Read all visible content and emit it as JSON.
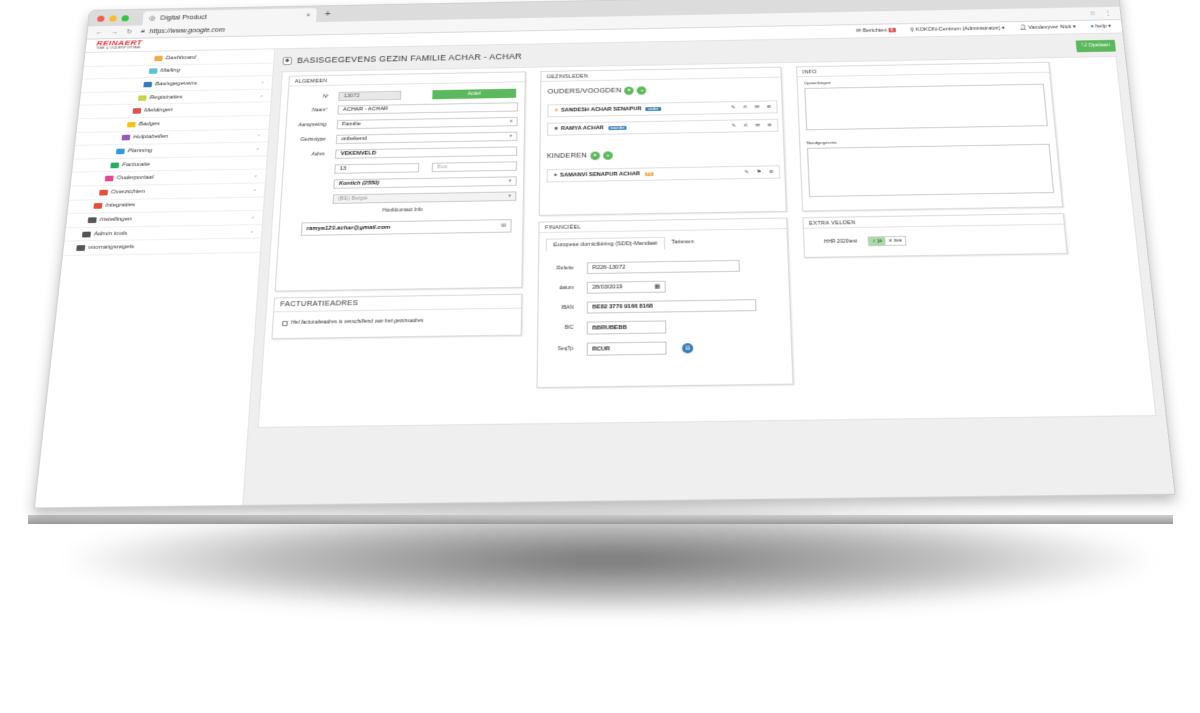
{
  "browser": {
    "tab_title": "Digital Product",
    "tab_close": "×",
    "new_tab": "+",
    "url": "https://www.google.com"
  },
  "header": {
    "logo_name": "REINAERT",
    "logo_sub": "TIBE & OUDERPORTAAL",
    "berichten": "Berichten",
    "berichten_count": "6",
    "location": "KOKON-Centrum (Administrator) ▾",
    "user": "Vandevyver Nick ▾",
    "help": "help ▾"
  },
  "sidebar": {
    "items": [
      {
        "label": "Dashboard",
        "color": "#f0ad4e",
        "chev": ""
      },
      {
        "label": "Mailing",
        "color": "#5bc0de",
        "chev": ""
      },
      {
        "label": "Basisgegevens",
        "color": "#337ab7",
        "chev": "‹"
      },
      {
        "label": "Registraties",
        "color": "#c8d44a",
        "chev": "‹"
      },
      {
        "label": "Meldingen",
        "color": "#d9534f",
        "chev": ""
      },
      {
        "label": "Badges",
        "color": "#f0c419",
        "chev": ""
      },
      {
        "label": "Hulptabellen",
        "color": "#9b59b6",
        "chev": "‹"
      },
      {
        "label": "Planning",
        "color": "#3498db",
        "chev": "‹"
      },
      {
        "label": "Facturatie",
        "color": "#27ae60",
        "chev": ""
      },
      {
        "label": "Ouderportaal",
        "color": "#e84393",
        "chev": "‹"
      },
      {
        "label": "Overzichten",
        "color": "#e74c3c",
        "chev": "‹"
      },
      {
        "label": "Integraties",
        "color": "#e74c3c",
        "chev": ""
      },
      {
        "label": "Instellingen",
        "color": "#555555",
        "chev": "‹"
      },
      {
        "label": "Admin tools",
        "color": "#555555",
        "chev": "‹"
      },
      {
        "label": "voorrangsregels",
        "color": "#555555",
        "chev": ""
      }
    ]
  },
  "page": {
    "title": "BASISGEGEVENS GEZIN FAMILIE ACHAR - ACHAR",
    "save_label": "Opslaan"
  },
  "algemeen": {
    "heading": "ALGEMEEN",
    "nr_label": "Nr",
    "nr_value": "13072",
    "status": "Actief",
    "naam_label": "Naam",
    "naam_value": "ACHAR - ACHAR",
    "aanspreking_label": "Aanspreking",
    "aanspreking_value": "Familie",
    "gezinstype_label": "Gezinstype",
    "gezinstype_value": "onbekend",
    "adres_label": "Adres",
    "straat_value": "VEKENVELD",
    "huisnr_value": "13",
    "bus_placeholder": "Bus",
    "gemeente_value": "Kontich (2550)",
    "land_value": "(BE) België",
    "hoofdcontact_label": "Hoofdcontact Info",
    "email": "ramya123.achar@gmail.com"
  },
  "facturatie": {
    "heading": "FACTURATIEADRES",
    "checkbox_label": "Het facturatieadres is verschillend van het gezinsadres"
  },
  "gezinsleden": {
    "heading": "GEZINSLEDEN",
    "ouders_title": "OUDERS/VOOGDEN",
    "kinderen_title": "KINDEREN",
    "ouders": [
      {
        "name": "SANDESH ACHAR SENAPUR",
        "role": "vader",
        "role_color": "#337ab7"
      },
      {
        "name": "RAMYA ACHAR",
        "role": "moeder",
        "role_color": "#337ab7"
      }
    ],
    "kinderen": [
      {
        "name": "SAMANVI SENAPUR ACHAR",
        "tag": "T1",
        "tag_color": "#f0ad4e"
      }
    ]
  },
  "financieel": {
    "heading": "FINANCIËEL",
    "tab_active": "Europese domiciliëring (SDD)-Mandaat",
    "tab_other": "Tarieven",
    "referte_label": "Referte",
    "referte_value": "R226-13072",
    "datum_label": "datum",
    "datum_value": "28/03/2019",
    "iban_label": "IBAN",
    "iban_value": "BE82 3770 9166 8168",
    "bic_label": "BIC",
    "bic_value": "BBRUBEBB",
    "seqtp_label": "SeqTp",
    "seqtp_value": "RCUR"
  },
  "info": {
    "heading": "INFO",
    "opmerkingen_label": "Opmerkingen",
    "noodgegevens_label": "Noodgegevens"
  },
  "extra": {
    "heading": "EXTRA VELDEN",
    "field_label": "HHR 2020test",
    "ja": "✓ ja",
    "nee": "✕ nee"
  }
}
